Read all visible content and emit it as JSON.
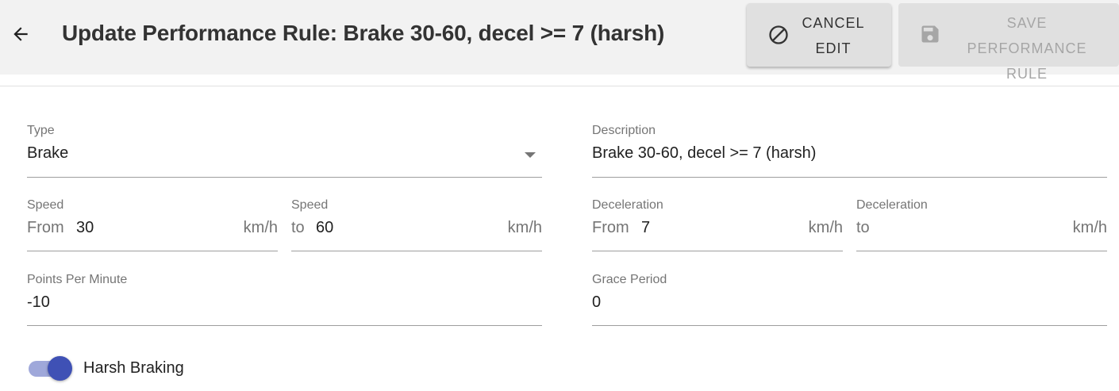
{
  "header": {
    "title": "Update Performance Rule: Brake 30-60, decel >= 7 (harsh)",
    "back_icon": "arrow-left-icon",
    "cancel_button": {
      "label": "CANCEL EDIT",
      "icon": "cancel-icon"
    },
    "save_button": {
      "label": "SAVE PERFORMANCE RULE",
      "icon": "save-icon",
      "disabled": true
    }
  },
  "form": {
    "type": {
      "label": "Type",
      "value": "Brake"
    },
    "description": {
      "label": "Description",
      "value": "Brake 30-60, decel >= 7 (harsh)"
    },
    "speed_from": {
      "label": "Speed",
      "prefix": "From",
      "value": "30",
      "unit": "km/h"
    },
    "speed_to": {
      "label": "Speed",
      "prefix": "to",
      "value": "60",
      "unit": "km/h"
    },
    "decel_from": {
      "label": "Deceleration",
      "prefix": "From",
      "value": "7",
      "unit": "km/h"
    },
    "decel_to": {
      "label": "Deceleration",
      "prefix": "to",
      "value": "",
      "unit": "km/h"
    },
    "points_per_minute": {
      "label": "Points Per Minute",
      "value": "-10"
    },
    "grace_period": {
      "label": "Grace Period",
      "value": "0"
    },
    "harsh_braking": {
      "label": "Harsh Braking",
      "checked": true
    }
  },
  "colors": {
    "accent": "#3f51b5",
    "accent_light": "#9fa8da",
    "header_bg": "#f2f2f2",
    "button_bg": "#e0e0e0"
  }
}
